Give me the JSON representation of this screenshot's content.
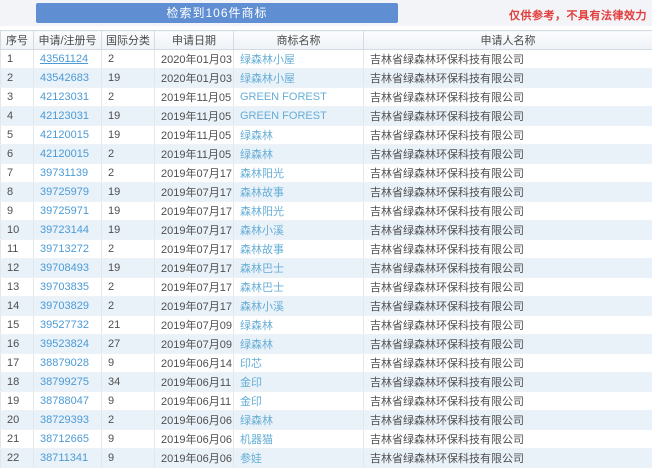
{
  "header": {
    "result_banner": "检索到106件商标",
    "disclaimer": "仅供参考，不具有法律效力"
  },
  "colors": {
    "banner_blue": "#5f8fd2",
    "disclaimer_red": "#e23c3c",
    "link_blue": "#4d9bd5",
    "trademark_blue": "#66aed6",
    "stripe": "#e9f1f9"
  },
  "table": {
    "columns": [
      "序号",
      "申请/注册号",
      "国际分类",
      "申请日期",
      "商标名称",
      "申请人名称"
    ],
    "rows": [
      {
        "no": "1",
        "reg_no": "43561124",
        "cls": "2",
        "date": "2020年01月03日",
        "name": "绿森林小屋",
        "applicant": "吉林省绿森林环保科技有限公司",
        "underlined": true
      },
      {
        "no": "2",
        "reg_no": "43542683",
        "cls": "19",
        "date": "2020年01月03日",
        "name": "绿森林小屋",
        "applicant": "吉林省绿森林环保科技有限公司",
        "underlined": false
      },
      {
        "no": "3",
        "reg_no": "42123031",
        "cls": "2",
        "date": "2019年11月05日",
        "name": "GREEN FOREST",
        "applicant": "吉林省绿森林环保科技有限公司",
        "underlined": false
      },
      {
        "no": "4",
        "reg_no": "42123031",
        "cls": "19",
        "date": "2019年11月05日",
        "name": "GREEN FOREST",
        "applicant": "吉林省绿森林环保科技有限公司",
        "underlined": false
      },
      {
        "no": "5",
        "reg_no": "42120015",
        "cls": "19",
        "date": "2019年11月05日",
        "name": "绿森林",
        "applicant": "吉林省绿森林环保科技有限公司",
        "underlined": false
      },
      {
        "no": "6",
        "reg_no": "42120015",
        "cls": "2",
        "date": "2019年11月05日",
        "name": "绿森林",
        "applicant": "吉林省绿森林环保科技有限公司",
        "underlined": false
      },
      {
        "no": "7",
        "reg_no": "39731139",
        "cls": "2",
        "date": "2019年07月17日",
        "name": "森林阳光",
        "applicant": "吉林省绿森林环保科技有限公司",
        "underlined": false
      },
      {
        "no": "8",
        "reg_no": "39725979",
        "cls": "19",
        "date": "2019年07月17日",
        "name": "森林故事",
        "applicant": "吉林省绿森林环保科技有限公司",
        "underlined": false
      },
      {
        "no": "9",
        "reg_no": "39725971",
        "cls": "19",
        "date": "2019年07月17日",
        "name": "森林阳光",
        "applicant": "吉林省绿森林环保科技有限公司",
        "underlined": false
      },
      {
        "no": "10",
        "reg_no": "39723144",
        "cls": "19",
        "date": "2019年07月17日",
        "name": "森林小溪",
        "applicant": "吉林省绿森林环保科技有限公司",
        "underlined": false
      },
      {
        "no": "11",
        "reg_no": "39713272",
        "cls": "2",
        "date": "2019年07月17日",
        "name": "森林故事",
        "applicant": "吉林省绿森林环保科技有限公司",
        "underlined": false
      },
      {
        "no": "12",
        "reg_no": "39708493",
        "cls": "19",
        "date": "2019年07月17日",
        "name": "森林巴士",
        "applicant": "吉林省绿森林环保科技有限公司",
        "underlined": false
      },
      {
        "no": "13",
        "reg_no": "39703835",
        "cls": "2",
        "date": "2019年07月17日",
        "name": "森林巴士",
        "applicant": "吉林省绿森林环保科技有限公司",
        "underlined": false
      },
      {
        "no": "14",
        "reg_no": "39703829",
        "cls": "2",
        "date": "2019年07月17日",
        "name": "森林小溪",
        "applicant": "吉林省绿森林环保科技有限公司",
        "underlined": false
      },
      {
        "no": "15",
        "reg_no": "39527732",
        "cls": "21",
        "date": "2019年07月09日",
        "name": "绿森林",
        "applicant": "吉林省绿森林环保科技有限公司",
        "underlined": false
      },
      {
        "no": "16",
        "reg_no": "39523824",
        "cls": "27",
        "date": "2019年07月09日",
        "name": "绿森林",
        "applicant": "吉林省绿森林环保科技有限公司",
        "underlined": false
      },
      {
        "no": "17",
        "reg_no": "38879028",
        "cls": "9",
        "date": "2019年06月14日",
        "name": "印芯",
        "applicant": "吉林省绿森林环保科技有限公司",
        "underlined": false
      },
      {
        "no": "18",
        "reg_no": "38799275",
        "cls": "34",
        "date": "2019年06月11日",
        "name": "金印",
        "applicant": "吉林省绿森林环保科技有限公司",
        "underlined": false
      },
      {
        "no": "19",
        "reg_no": "38788047",
        "cls": "9",
        "date": "2019年06月11日",
        "name": "金印",
        "applicant": "吉林省绿森林环保科技有限公司",
        "underlined": false
      },
      {
        "no": "20",
        "reg_no": "38729393",
        "cls": "2",
        "date": "2019年06月06日",
        "name": "绿森林",
        "applicant": "吉林省绿森林环保科技有限公司",
        "underlined": false
      },
      {
        "no": "21",
        "reg_no": "38712665",
        "cls": "9",
        "date": "2019年06月06日",
        "name": "机器猫",
        "applicant": "吉林省绿森林环保科技有限公司",
        "underlined": false
      },
      {
        "no": "22",
        "reg_no": "38711341",
        "cls": "9",
        "date": "2019年06月06日",
        "name": "参娃",
        "applicant": "吉林省绿森林环保科技有限公司",
        "underlined": false
      }
    ]
  }
}
